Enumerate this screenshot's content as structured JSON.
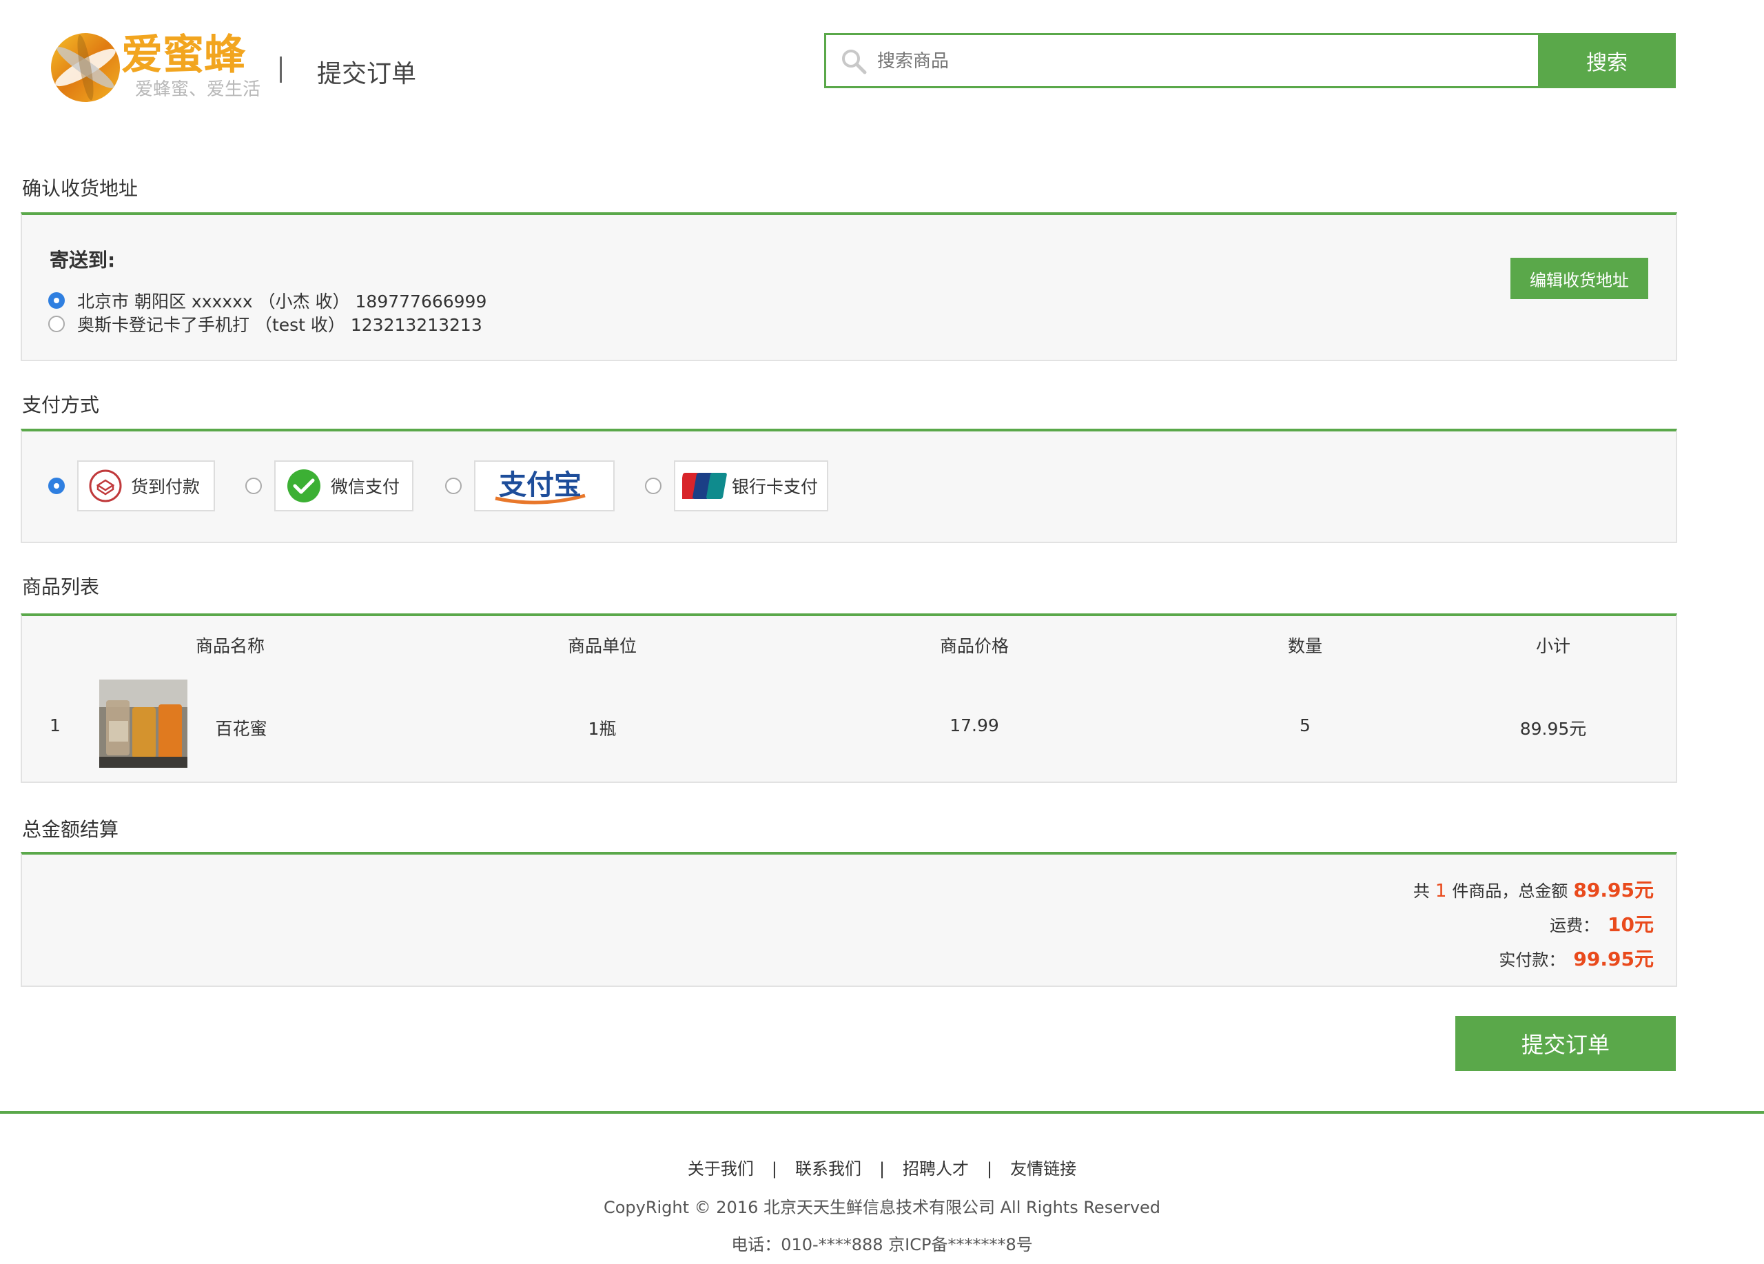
{
  "header": {
    "logo_text": "爱蜜蜂",
    "logo_tagline": "爱蜂蜜、爱生活",
    "page_title": "提交订单",
    "search_placeholder": "搜索商品",
    "search_button": "搜索"
  },
  "address": {
    "section_title": "确认收货地址",
    "ship_to_label": "寄送到:",
    "edit_button": "编辑收货地址",
    "options": [
      {
        "text": "北京市 朝阳区 xxxxxx （小杰 收） 189777666999",
        "selected": true
      },
      {
        "text": "奥斯卡登记卡了手机打 （test 收） 123213213213",
        "selected": false
      }
    ]
  },
  "payment": {
    "section_title": "支付方式",
    "options": [
      {
        "label": "货到付款",
        "icon": "cod-icon",
        "selected": true
      },
      {
        "label": "微信支付",
        "icon": "wechat-icon",
        "selected": false
      },
      {
        "label": "支付宝",
        "icon": "alipay-logo",
        "selected": false
      },
      {
        "label": "银行卡支付",
        "icon": "unionpay-icon",
        "selected": false
      }
    ]
  },
  "goods": {
    "section_title": "商品列表",
    "columns": [
      "商品名称",
      "商品单位",
      "商品价格",
      "数量",
      "小计"
    ],
    "rows": [
      {
        "index": "1",
        "name": "百花蜜",
        "unit": "1瓶",
        "price": "17.99",
        "qty": "5",
        "subtotal": "89.95元"
      }
    ]
  },
  "summary": {
    "section_title": "总金额结算",
    "count_prefix": "共",
    "count": "1",
    "count_suffix": "件商品，总金额",
    "total": "89.95元",
    "shipping_label": "运费：",
    "shipping": "10元",
    "payable_label": "实付款：",
    "payable": "99.95元"
  },
  "submit_button": "提交订单",
  "footer": {
    "links": [
      "关于我们",
      "联系我们",
      "招聘人才",
      "友情链接"
    ],
    "copyright": "CopyRight © 2016 北京天天生鲜信息技术有限公司 All Rights Reserved",
    "phone": "电话：010-****888 京ICP备*******8号"
  },
  "colors": {
    "accent": "#5aa84a",
    "price": "#e94a1c",
    "radio": "#2f7fe0"
  }
}
